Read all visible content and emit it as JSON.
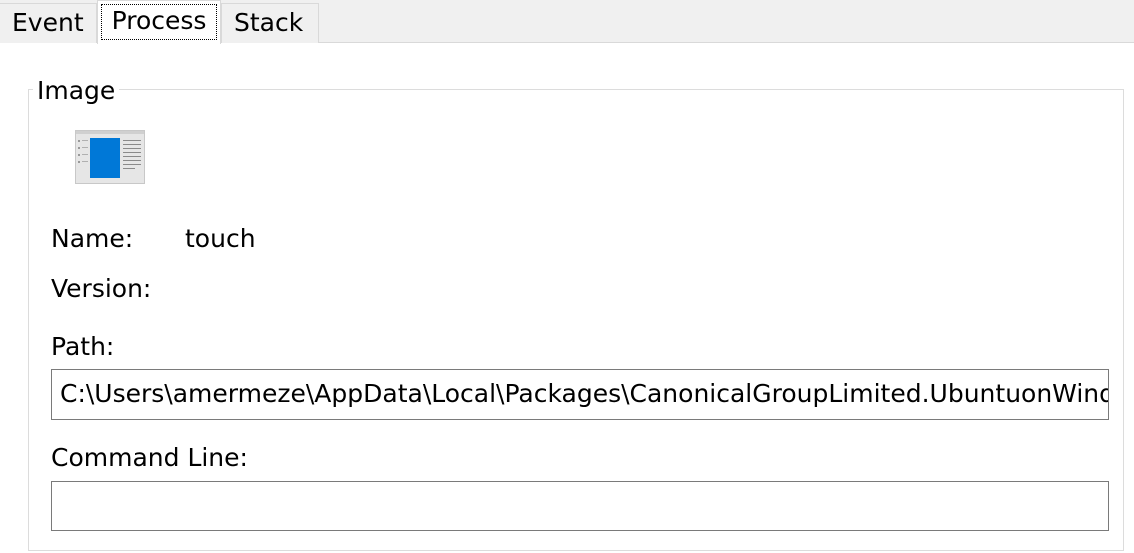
{
  "tabs": [
    {
      "label": "Event"
    },
    {
      "label": "Process",
      "selected": true
    },
    {
      "label": "Stack"
    }
  ],
  "image_group": {
    "title": "Image",
    "icon": "application-window-icon",
    "name_label": "Name:",
    "name_value": "touch",
    "version_label": "Version:",
    "path_label": "Path:",
    "path_value": "C:\\Users\\amermeze\\AppData\\Local\\Packages\\CanonicalGroupLimited.UbuntuonWindows",
    "command_line_label": "Command Line:",
    "command_line_value": ""
  },
  "colors": {
    "tabstrip_bg": "#f0f0f0",
    "icon_blue": "#0078d7",
    "border": "#7a7a7a"
  }
}
